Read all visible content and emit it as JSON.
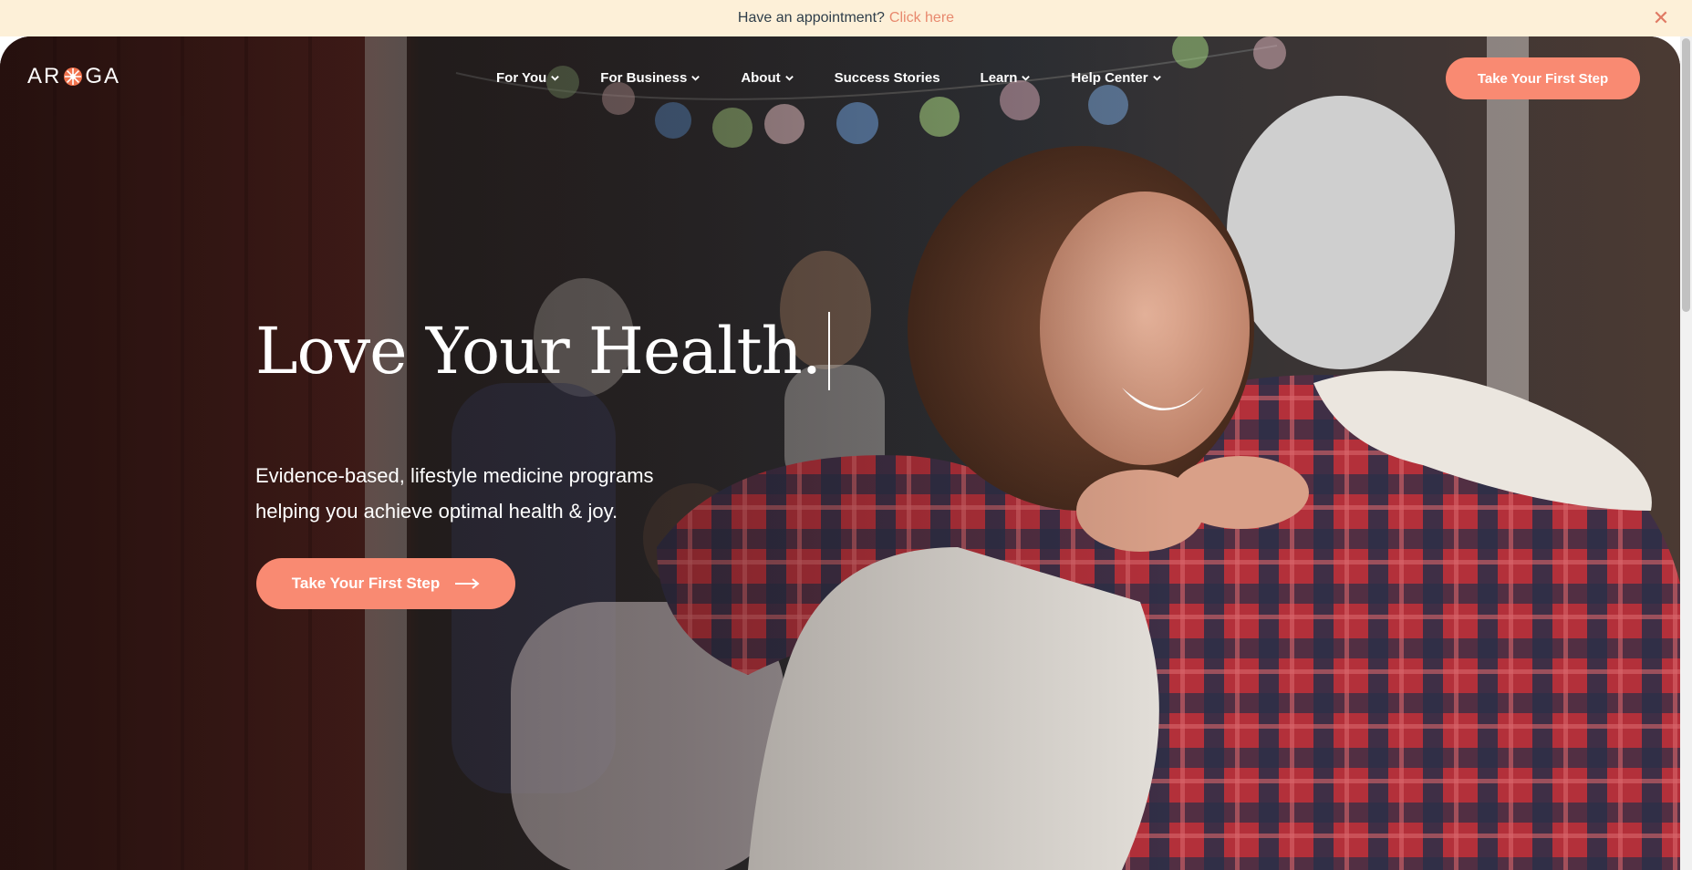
{
  "announcement": {
    "text": "Have an appointment?",
    "link_label": "Click here",
    "close_icon": "close-icon"
  },
  "brand": {
    "logo_text_left": "AR",
    "logo_text_right": "GA",
    "logo_mark_icon": "wheel-logo-icon",
    "accent_color": "#f98a72",
    "link_color": "#e8896e"
  },
  "nav": {
    "items": [
      {
        "label": "For You",
        "has_dropdown": true
      },
      {
        "label": "For Business",
        "has_dropdown": true
      },
      {
        "label": "About",
        "has_dropdown": true
      },
      {
        "label": "Success Stories",
        "has_dropdown": false
      },
      {
        "label": "Learn",
        "has_dropdown": true
      },
      {
        "label": "Help Center",
        "has_dropdown": true
      }
    ],
    "cta_label": "Take Your First Step"
  },
  "hero": {
    "headline": "Love Your Health.",
    "subtext_line1": "Evidence-based, lifestyle medicine programs",
    "subtext_line2": "helping you achieve optimal health & joy.",
    "cta_label": "Take Your First Step",
    "cta_icon": "arrow-right-icon"
  }
}
